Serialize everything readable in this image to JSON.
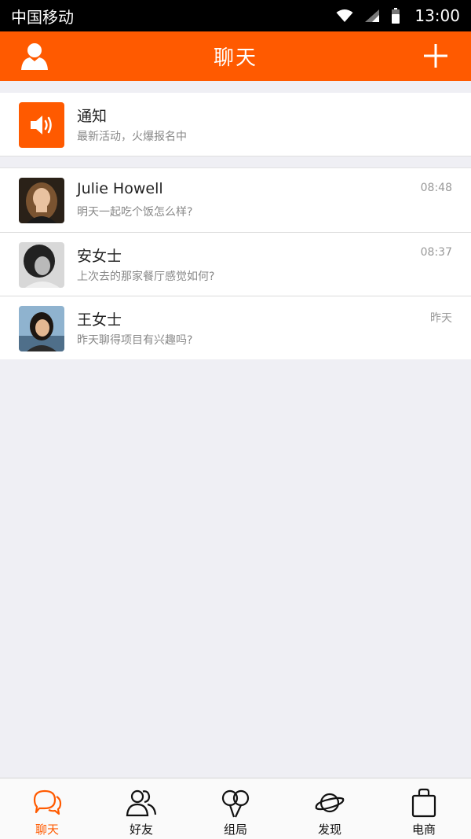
{
  "status_bar": {
    "carrier": "中国移动",
    "time": "13:00"
  },
  "header": {
    "title": "聊天",
    "left_icon": "profile-icon",
    "right_icon": "plus-icon"
  },
  "notice": {
    "title": "通知",
    "subtitle": "最新活动，火爆报名中",
    "icon": "speaker-icon"
  },
  "chats": [
    {
      "name": "Julie Howell",
      "message": "明天一起吃个饭怎么样?",
      "time": "08:48"
    },
    {
      "name": "安女士",
      "message": "上次去的那家餐厅感觉如何?",
      "time": "08:37"
    },
    {
      "name": "王女士",
      "message": "昨天聊得项目有兴趣吗?",
      "time": "昨天"
    }
  ],
  "tabs": [
    {
      "label": "聊天",
      "icon": "chat-bubbles-icon",
      "active": true
    },
    {
      "label": "好友",
      "icon": "friends-icon",
      "active": false
    },
    {
      "label": "组局",
      "icon": "balloons-icon",
      "active": false
    },
    {
      "label": "发现",
      "icon": "planet-icon",
      "active": false
    },
    {
      "label": "电商",
      "icon": "shopping-bag-icon",
      "active": false
    }
  ],
  "colors": {
    "accent": "#ff5a00",
    "background": "#efeff4"
  }
}
